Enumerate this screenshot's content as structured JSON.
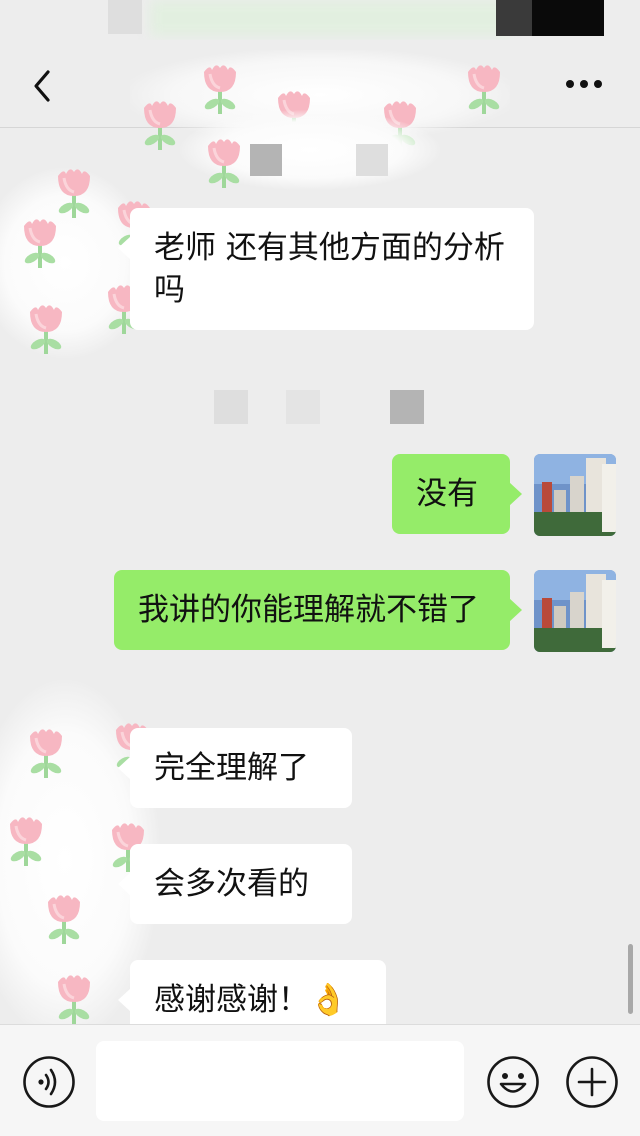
{
  "messages": [
    {
      "from": "other",
      "text": "老师 还有其他方面的分析吗"
    },
    {
      "from": "me",
      "text": "没有"
    },
    {
      "from": "me",
      "text": "我讲的你能理解就不错了"
    },
    {
      "from": "other",
      "text": "完全理解了"
    },
    {
      "from": "other",
      "text": "会多次看的"
    },
    {
      "from": "other",
      "text": "感谢感谢！👌"
    }
  ],
  "input": {
    "value": "",
    "placeholder": ""
  },
  "colors": {
    "background": "#ededed",
    "sent_bubble": "#95ec69",
    "received_bubble": "#ffffff",
    "input_bar": "#f6f6f6"
  },
  "icons": {
    "back": "back-icon",
    "more": "more-icon",
    "voice": "voice-icon",
    "emoji": "emoji-icon",
    "plus": "plus-icon"
  }
}
